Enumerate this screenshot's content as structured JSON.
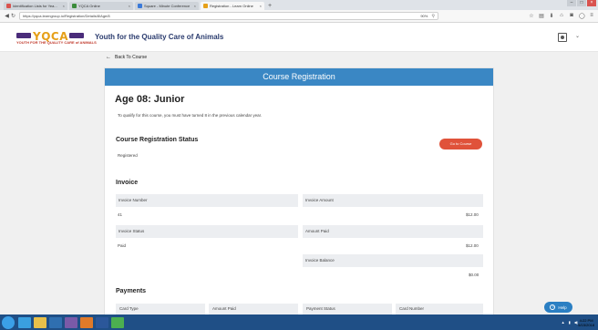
{
  "browser": {
    "tabs": [
      {
        "label": "Identification Lists for Yea...",
        "color": "#d9534f",
        "active": false
      },
      {
        "label": "YQCA Online",
        "color": "#3b8b3b",
        "active": false
      },
      {
        "label": "Square - Minute Conference",
        "color": "#3b7ad9",
        "active": false
      },
      {
        "label": "Registration - Learn Online",
        "color": "#e6a019",
        "active": true
      }
    ],
    "new_tab": "+",
    "url": "https://yqca.learngroup.io/Registration/Details/8/Age/8",
    "zoom": "90%",
    "window_controls": [
      "–",
      "□",
      "×"
    ]
  },
  "site": {
    "logo_text": "YQCA",
    "logo_sub": "YOUTH FOR THE QUALITY CARE of ANIMALS",
    "title": "Youth for the Quality Care of Animals",
    "back_label": "Back To Course"
  },
  "card": {
    "header": "Course Registration",
    "age_title": "Age 08: Junior",
    "age_desc": "To qualify for this course, you must have turned 8 in the previous calendar year.",
    "status_title": "Course Registration Status",
    "status_value": "Registered",
    "goto_label": "Go to Course",
    "invoice_title": "Invoice",
    "invoice_number_label": "Invoice Number",
    "invoice_number_value": "41",
    "invoice_amount_label": "Invoice Amount",
    "invoice_amount_value": "$12.00",
    "invoice_status_label": "Invoice Status",
    "invoice_status_value": "Paid",
    "amount_paid_label": "Amount Paid",
    "amount_paid_value": "$12.00",
    "invoice_balance_label": "Invoice Balance",
    "invoice_balance_value": "$0.00",
    "payments_title": "Payments",
    "payment_columns": [
      "Card Type",
      "Amount Paid",
      "Payment Status",
      "Card Number"
    ]
  },
  "help_label": "Help",
  "taskbar": {
    "clock_time": "4:22 PM",
    "clock_date": "5/15/2018"
  }
}
